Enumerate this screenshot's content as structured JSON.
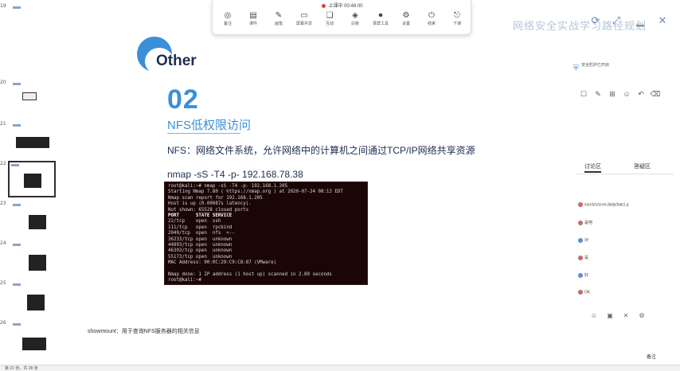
{
  "toolbar": {
    "status": "上课中 00:48:00",
    "buttons": [
      {
        "label": "备注",
        "icon": "speaker-icon"
      },
      {
        "label": "课件",
        "icon": "document-icon"
      },
      {
        "label": "画笔",
        "icon": "pen-icon"
      },
      {
        "label": "屏幕共享",
        "icon": "screen-share-icon"
      },
      {
        "label": "互动",
        "icon": "clipboard-icon"
      },
      {
        "label": "白板",
        "icon": "whiteboard-icon"
      },
      {
        "label": "录屏工具",
        "icon": "record-icon"
      },
      {
        "label": "设置",
        "icon": "gear-icon"
      },
      {
        "label": "结束",
        "icon": "power-icon"
      },
      {
        "label": "下课",
        "icon": "exit-icon"
      }
    ]
  },
  "window_title": "网络安全实战学习路径规划",
  "thumbnails": {
    "items": [
      {
        "num": "19"
      },
      {
        "num": "20"
      },
      {
        "num": "21"
      },
      {
        "num": "22"
      },
      {
        "num": "23"
      },
      {
        "num": "24"
      },
      {
        "num": "25"
      },
      {
        "num": "26"
      }
    ]
  },
  "slide": {
    "logo_text": "Other",
    "section_number": "02",
    "section_title": "NFS低权限访问",
    "description": "NFS：网络文件系统，允许网络中的计算机之间通过TCP/IP网络共享资源",
    "command": "nmap -sS -T4 -p- 192.168.78.38",
    "terminal": {
      "lines": [
        "root@kali:~# nmap -sS -T4 -p- 192.168.1.205",
        "Starting Nmap 7.80 ( https://nmap.org ) at 2020-07-24 08:13 EDT",
        "Nmap scan report for 192.168.1.205",
        "Host is up (0.00087s latency).",
        "Not shown: 65528 closed ports",
        "PORT      STATE SERVICE",
        "22/tcp    open  ssh",
        "111/tcp   open  rpcbind",
        "2049/tcp  open  nfs  <--",
        "36233/tcp open  unknown",
        "44893/tcp open  unknown",
        "46303/tcp open  unknown",
        "55173/tcp open  unknown",
        "MAC Address: 00:0C:29:C9:C8:87 (VMware)",
        "",
        "Nmap done: 1 IP address (1 host up) scanned in 2.89 seconds",
        "root@kali:~# "
      ]
    },
    "caption": "showmount：用于查询NFS服务器的相关信息"
  },
  "side_panel": {
    "security_label": "安全防护已开启",
    "tabs": [
      "讨论区",
      "答疑区"
    ],
    "comments": [
      "/usr/src/cron.daily/bak1.p",
      "是吧",
      "对",
      "是",
      "好",
      "OK"
    ],
    "tools": [
      "☐",
      "✎",
      "⊞",
      "☺",
      "↶",
      "⌫"
    ]
  },
  "status_bar": {
    "left": "第 22 张，共 28 张",
    "right": "备注"
  },
  "colors": {
    "accent": "#3b8fd9",
    "heading": "#1d2e4f",
    "terminal_bg": "#1b0606"
  }
}
